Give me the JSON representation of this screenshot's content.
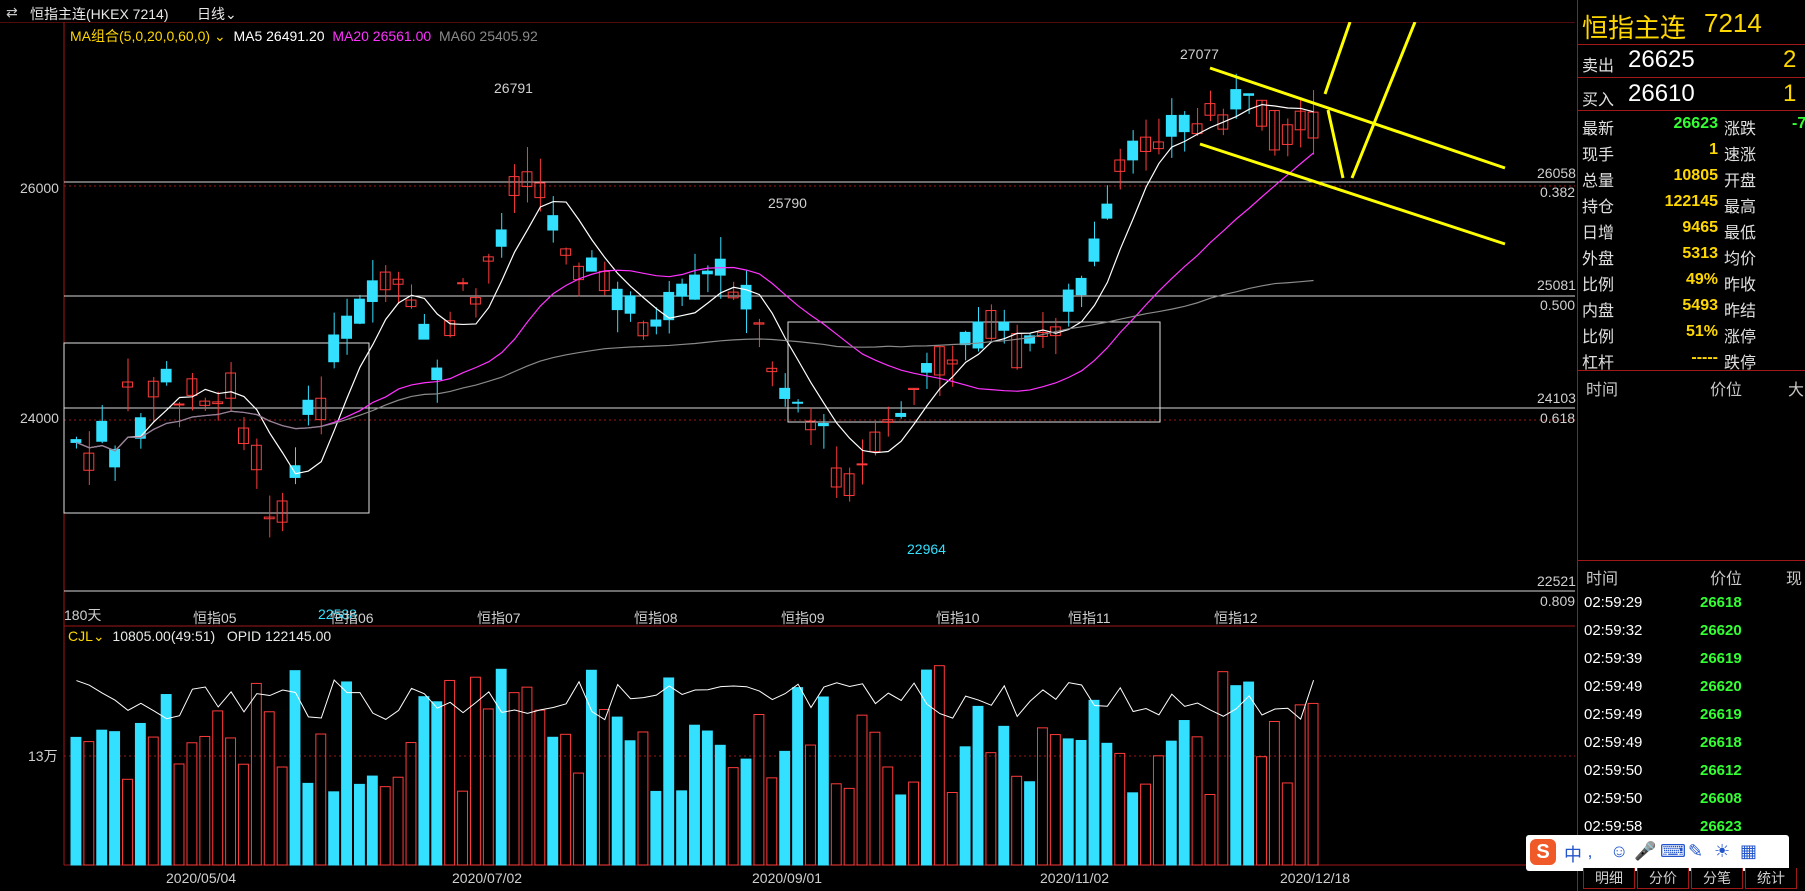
{
  "topbar": {
    "icon": "swap-arrows-icon",
    "title": "恒指主连(HKEX 7214)",
    "period": "日线"
  },
  "ma_legend": {
    "group": "MA组合(5,0,20,0,60,0)",
    "ma5": "MA5 26491.20",
    "ma20": "MA20 26561.00",
    "ma60": "MA60 25405.92",
    "colors": {
      "ma5": "#ffffff",
      "ma20": "#ff33ff",
      "ma60": "#8a8a8a"
    }
  },
  "price_axis": [
    "26000",
    "24000"
  ],
  "fib_levels": [
    {
      "price": "26058",
      "ratio": "0.382"
    },
    {
      "price": "25081",
      "ratio": "0.500"
    },
    {
      "price": "24103",
      "ratio": "0.618"
    },
    {
      "price": "22521",
      "ratio": "0.809"
    }
  ],
  "annotations": [
    "27077",
    "26791",
    "25790",
    "22964",
    "22588"
  ],
  "period_label": "180天",
  "month_labels": [
    "恒指05",
    "恒指06",
    "恒指07",
    "恒指08",
    "恒指09",
    "恒指10",
    "恒指11",
    "恒指12"
  ],
  "volume_legend": {
    "name": "CJL",
    "value": "10805.00(49:51)",
    "opid": "OPID 122145.00"
  },
  "volume_axis": "13万",
  "date_axis": [
    "2020/05/04",
    "2020/07/02",
    "2020/09/01",
    "2020/11/02",
    "2020/12/18"
  ],
  "quote": {
    "name": "恒指主连",
    "code": "7214",
    "sell_label": "卖出",
    "sell_price": "26625",
    "sell_qty": "2",
    "buy_label": "买入",
    "buy_price": "26610",
    "buy_qty": "1",
    "fields": [
      {
        "label": "最新",
        "value": "26623",
        "label2": "涨跌",
        "value2": "-7"
      },
      {
        "label": "现手",
        "value": "1",
        "label2": "速涨",
        "value2": ""
      },
      {
        "label": "总量",
        "value": "10805",
        "label2": "开盘",
        "value2": ""
      },
      {
        "label": "持仓",
        "value": "122145",
        "label2": "最高",
        "value2": ""
      },
      {
        "label": "日增",
        "value": "9465",
        "label2": "最低",
        "value2": ""
      },
      {
        "label": "外盘",
        "value": "5313",
        "label2": "均价",
        "value2": ""
      },
      {
        "label": "比例",
        "value": "49%",
        "label2": "昨收",
        "value2": ""
      },
      {
        "label": "内盘",
        "value": "5493",
        "label2": "昨结",
        "value2": ""
      },
      {
        "label": "比例",
        "value": "51%",
        "label2": "涨停",
        "value2": ""
      },
      {
        "label": "杠杆",
        "value": "-----",
        "label2": "跌停",
        "value2": ""
      }
    ]
  },
  "ticks_header": {
    "time": "时间",
    "price": "价位",
    "vol": "大"
  },
  "trades_header": {
    "time": "时间",
    "price": "价位",
    "vol": "现"
  },
  "trades": [
    {
      "time": "02:59:29",
      "price": "26618"
    },
    {
      "time": "02:59:32",
      "price": "26620"
    },
    {
      "time": "02:59:39",
      "price": "26619"
    },
    {
      "time": "02:59:49",
      "price": "26620"
    },
    {
      "time": "02:59:49",
      "price": "26619"
    },
    {
      "time": "02:59:49",
      "price": "26618"
    },
    {
      "time": "02:59:50",
      "price": "26612"
    },
    {
      "time": "02:59:50",
      "price": "26608"
    },
    {
      "time": "02:59:58",
      "price": "26623"
    }
  ],
  "bottom_tabs": [
    "明细",
    "分价",
    "分笔",
    "统计"
  ],
  "ime": {
    "brand": "S",
    "lang": "中"
  }
}
